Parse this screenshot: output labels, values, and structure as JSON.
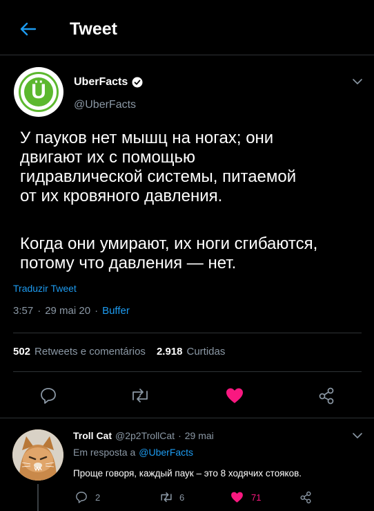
{
  "header": {
    "title": "Tweet"
  },
  "tweet": {
    "author_name": "UberFacts",
    "author_handle": "@UberFacts",
    "avatar_letter": "Ü",
    "body_p1_lines": [
      "У пауков нет мышц на ногах; они",
      "двигают их с помощью",
      "гидравлической системы, питаемой",
      "от их кровяного давления."
    ],
    "body_p2_lines": [
      "Когда они умирают, их ноги сгибаются,",
      "потому что давления — нет."
    ],
    "translate_label": "Traduzir Tweet",
    "time": "3:57",
    "sep1": "·",
    "date": "29 mai 20",
    "sep2": "·",
    "source": "Buffer",
    "retweets_count": "502",
    "retweets_label": "Retweets e comentários",
    "likes_count": "2.918",
    "likes_label": "Curtidas"
  },
  "reply": {
    "author_name": "Troll Cat",
    "author_handle": "@2p2TrollCat",
    "sep": "·",
    "date": "29 mai",
    "reply_to_label": "Em resposta a",
    "reply_to_handle": "@UberFacts",
    "text": "Проще говоря, каждый паук – это 8 ходячих стояков.",
    "reply_count": "2",
    "retweet_count": "6",
    "like_count": "71"
  },
  "colors": {
    "accent": "#1d9bf0",
    "like": "#f91880",
    "avatar_green": "#5cb82e",
    "muted": "#8b98a5"
  }
}
